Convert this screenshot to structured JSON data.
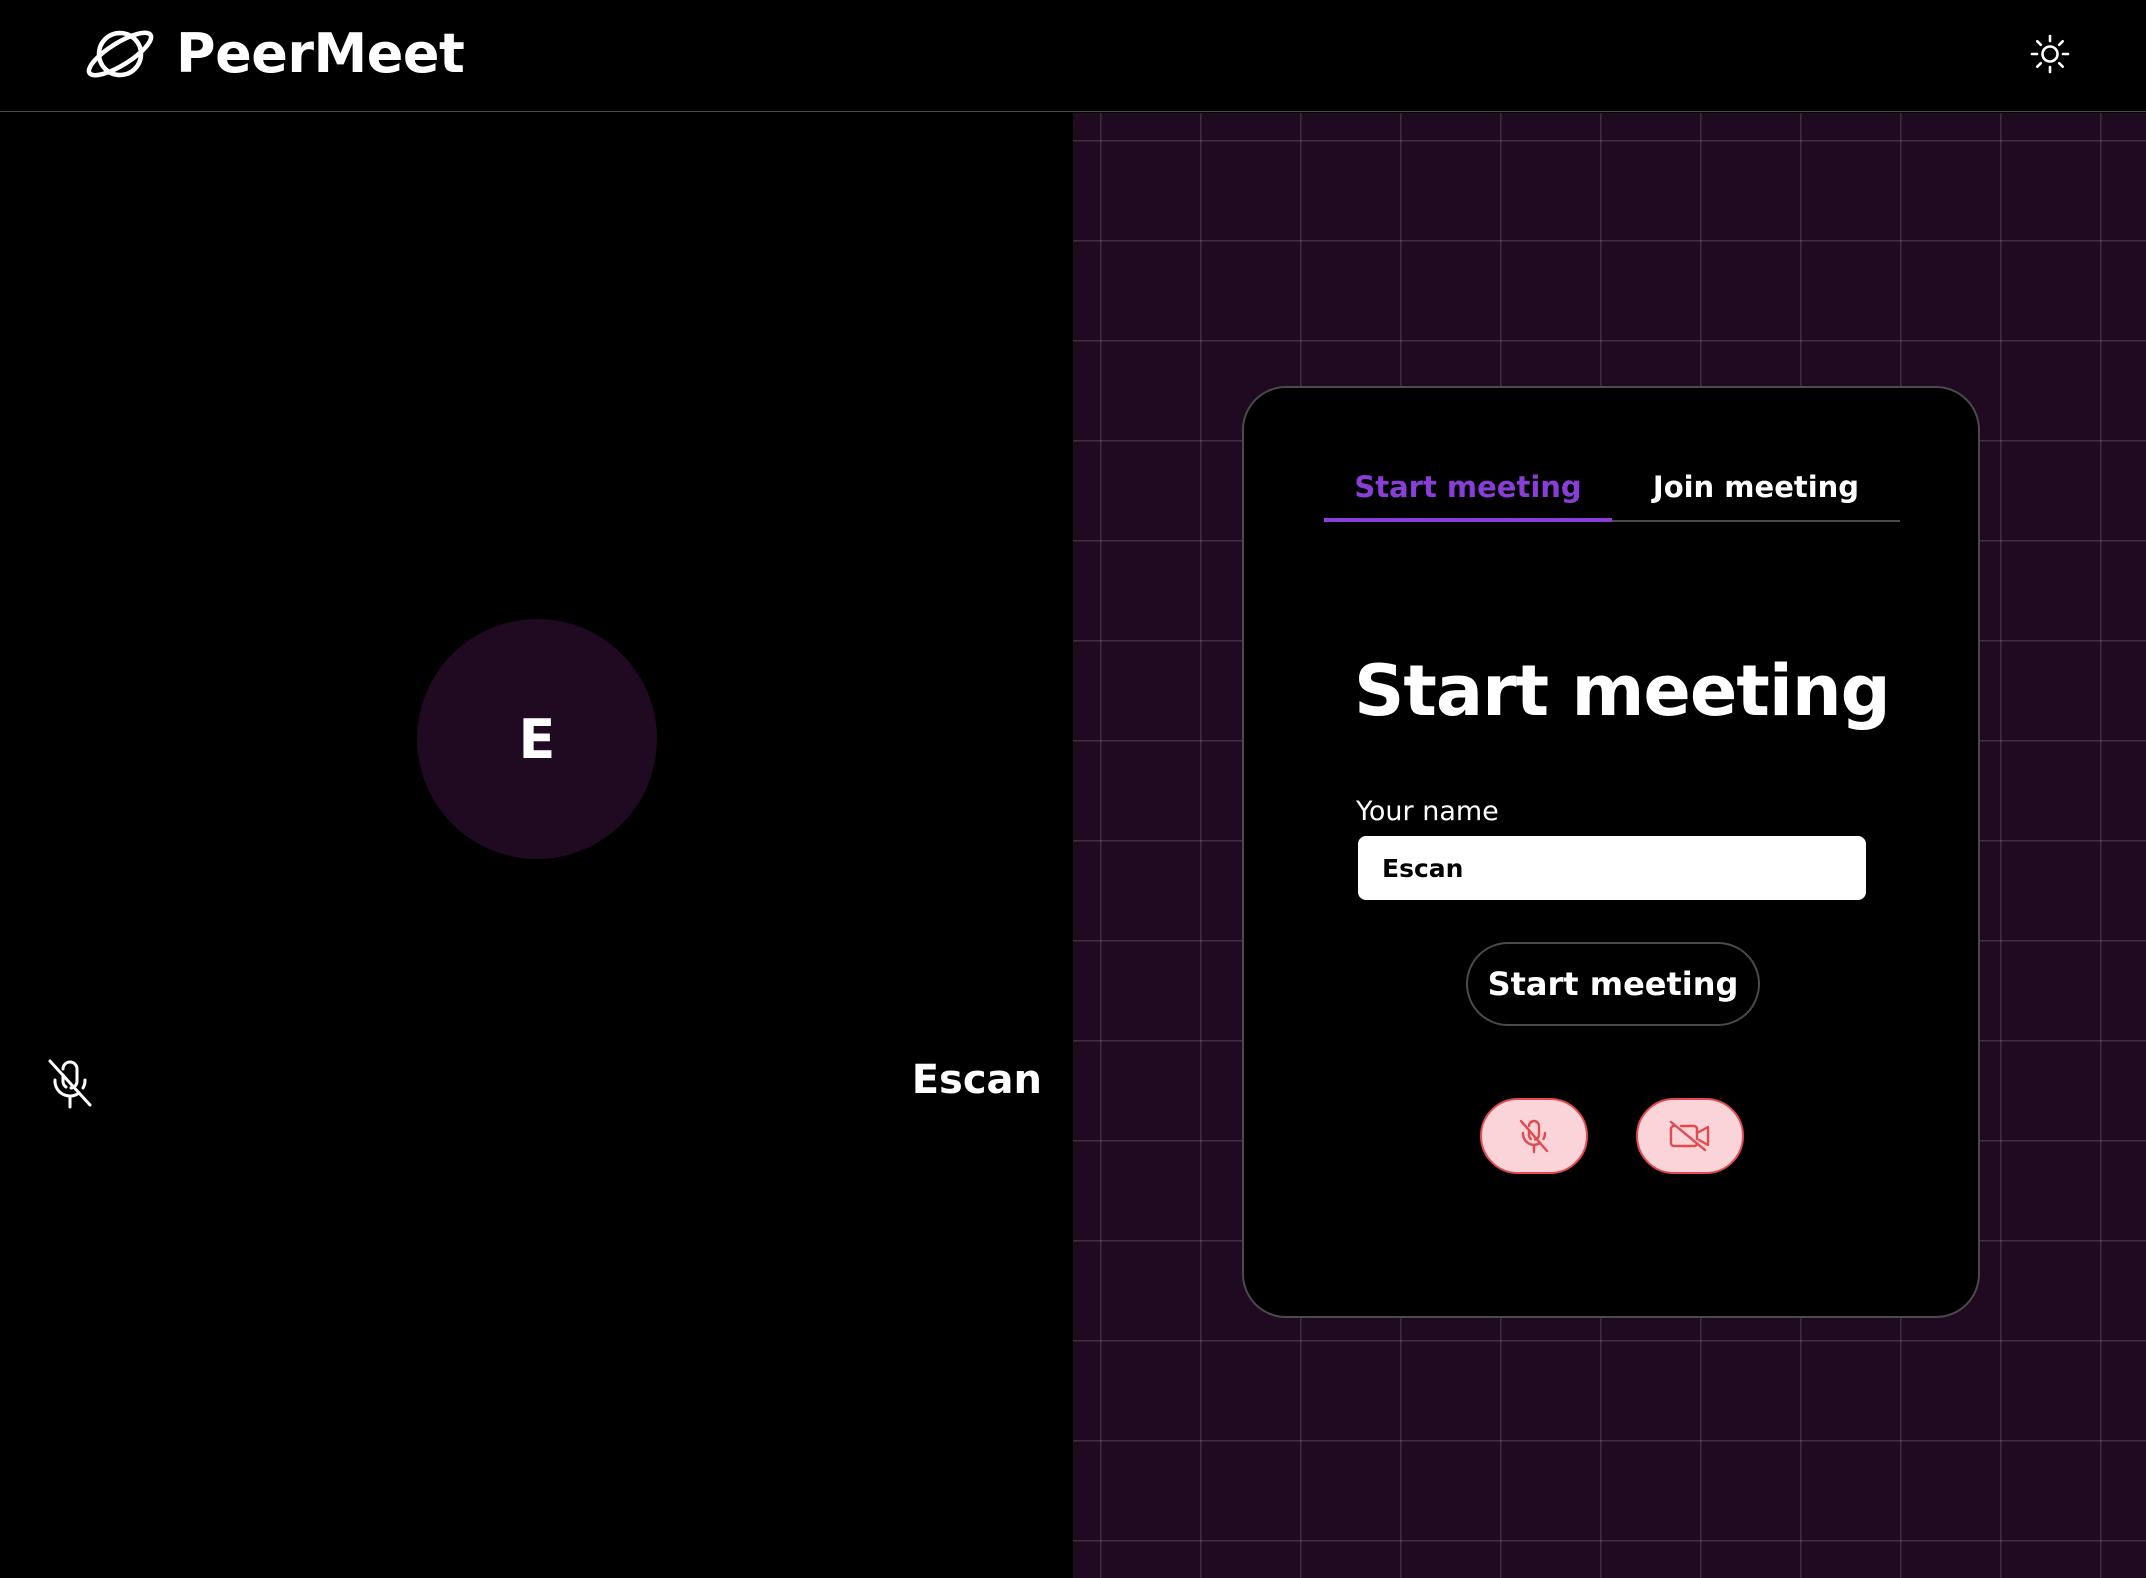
{
  "header": {
    "brand": "PeerMeet",
    "logo_icon": "planet-icon",
    "theme_icon": "sun-icon"
  },
  "preview": {
    "avatar_initial": "E",
    "participant_name": "Escan",
    "mic_icon": "mic-off-icon"
  },
  "card": {
    "tabs": [
      {
        "label": "Start meeting",
        "active": true
      },
      {
        "label": "Join meeting",
        "active": false
      }
    ],
    "title": "Start meeting",
    "name_label": "Your name",
    "name_value": "Escan",
    "start_button": "Start meeting",
    "mic_toggle_icon": "mic-off-icon",
    "camera_toggle_icon": "camera-off-icon"
  },
  "colors": {
    "accent": "#8a3ed8",
    "panel_bg": "#1f0a21",
    "danger_bg": "#fad4d8",
    "danger": "#e14a4f"
  }
}
